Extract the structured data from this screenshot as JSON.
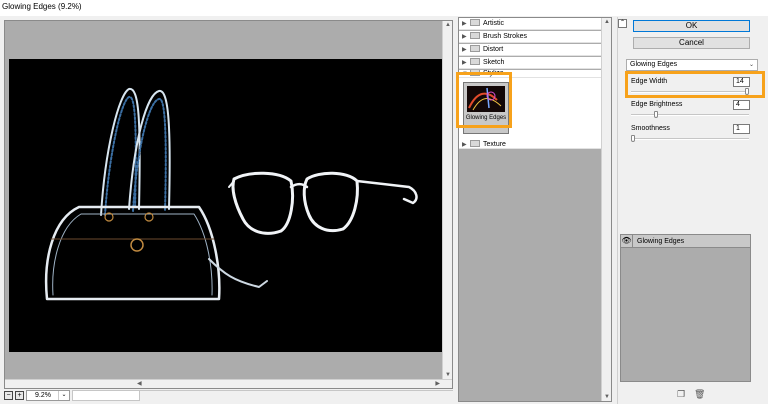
{
  "window": {
    "title": "Glowing Edges (9.2%)"
  },
  "preview": {
    "zoom_minus": "−",
    "zoom_plus": "+",
    "zoom_value": "9.2%"
  },
  "gallery": {
    "folders_top": [
      "Artistic",
      "Brush Strokes",
      "Distort",
      "Sketch"
    ],
    "partial_folder": "Stylize",
    "thumb_label": "Glowing Edges",
    "folder_bottom": "Texture"
  },
  "panel": {
    "ok_label": "OK",
    "cancel_label": "Cancel",
    "filter_select": "Glowing Edges",
    "params": [
      {
        "label": "Edge Width",
        "value": "14",
        "level": 1.0
      },
      {
        "label": "Edge Brightness",
        "value": "4",
        "level": 0.2
      },
      {
        "label": "Smoothness",
        "value": "1",
        "level": 0.0
      }
    ],
    "effect_layer": "Glowing Edges",
    "highlight_color": "#f7a21b"
  }
}
